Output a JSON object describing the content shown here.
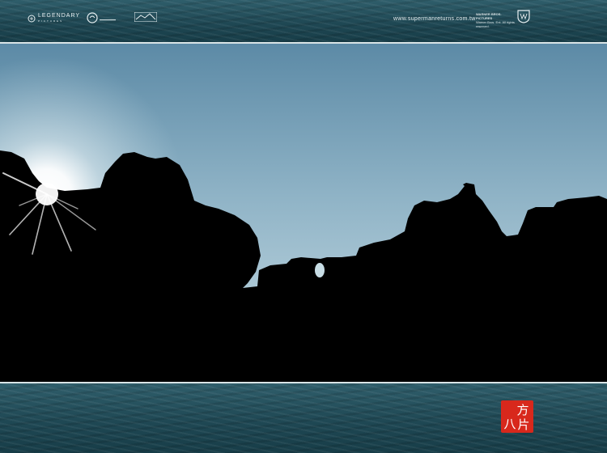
{
  "header": {
    "logo_legendary": "LEGENDARY",
    "logo_legendary_sub": "PICTURES",
    "url": "www.supermanreturns.com.tw",
    "credit_line1": "WARNER BROS. PICTURES",
    "credit_line2": "Warner Bros. Ent. All rights reserved.",
    "icons": [
      "legendary-logo",
      "dc-logo",
      "studio-logo",
      "wb-shield-logo"
    ]
  },
  "photo": {
    "subject": "silhouetted rocks at sunset"
  },
  "seal": {
    "chars": [
      "方",
      "八",
      "片"
    ],
    "color": "#d8281c"
  },
  "colors": {
    "sky_top": "#5a87a4",
    "sky_horizon": "#c6dbe4",
    "water": "#2a5662",
    "rock": "#000000"
  }
}
